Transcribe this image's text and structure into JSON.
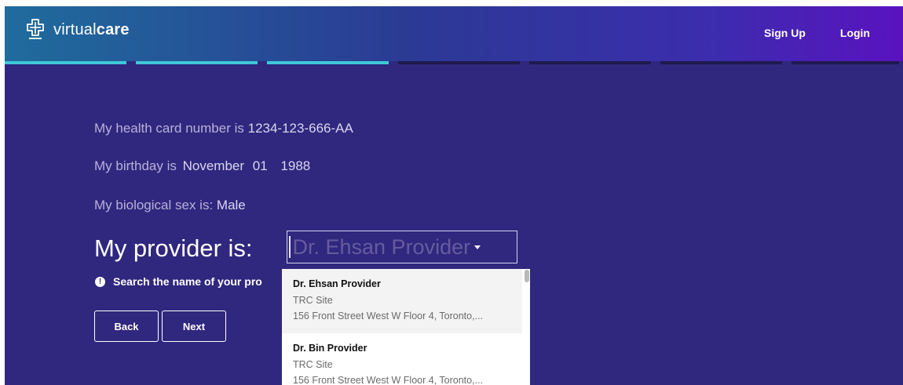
{
  "header": {
    "logo_prefix": "virtual",
    "logo_suffix": "care",
    "nav": {
      "signup": "Sign Up",
      "login": "Login"
    },
    "progress": {
      "total_steps": 7,
      "completed_steps": 3,
      "done_color": "#3fc8d8",
      "todo_color": "#1f1a4e"
    }
  },
  "colors": {
    "background": "#30277e",
    "gradient_start": "#1f6c9c",
    "gradient_end": "#5a12bf"
  },
  "form": {
    "health_card": {
      "label": "My health card number is",
      "value": "1234-123-666-AA"
    },
    "birthday": {
      "label": "My birthday is",
      "month": "November",
      "day": "01",
      "year": "1988"
    },
    "sex": {
      "label": "My biological sex is:",
      "value": "Male"
    },
    "provider": {
      "label": "My provider is:",
      "value": "Dr. Ehsan Provider"
    },
    "hint": "Search the name of your pro",
    "hint_icon": "exclamation-circle-icon",
    "back_label": "Back",
    "next_label": "Next"
  },
  "dropdown": {
    "options": [
      {
        "name": "Dr. Ehsan Provider",
        "site": "TRC Site",
        "address": "156 Front Street West W Floor 4, Toronto,..."
      },
      {
        "name": "Dr. Bin Provider",
        "site": "TRC Site",
        "address": "156 Front Street West W Floor 4, Toronto,..."
      }
    ]
  }
}
